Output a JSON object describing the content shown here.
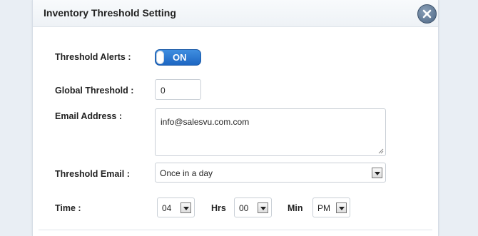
{
  "dialog": {
    "title": "Inventory Threshold Setting"
  },
  "form": {
    "threshold_alerts_label": "Threshold Alerts :",
    "threshold_alerts_toggle": "ON",
    "global_threshold_label": "Global Threshold :",
    "global_threshold_value": "0",
    "email_address_label": "Email Address :",
    "email_address_value": "info@salesvu.com.com",
    "threshold_email_label": "Threshold Email :",
    "threshold_email_selected": "Once in a day",
    "time_label": "Time :",
    "hours_value": "04",
    "hours_unit": "Hrs",
    "minutes_value": "00",
    "minutes_unit": "Min",
    "ampm_value": "PM"
  },
  "colors": {
    "toggle_on": "#1d66c2",
    "close_button": "#4d6684",
    "background": "#e9eef4"
  }
}
